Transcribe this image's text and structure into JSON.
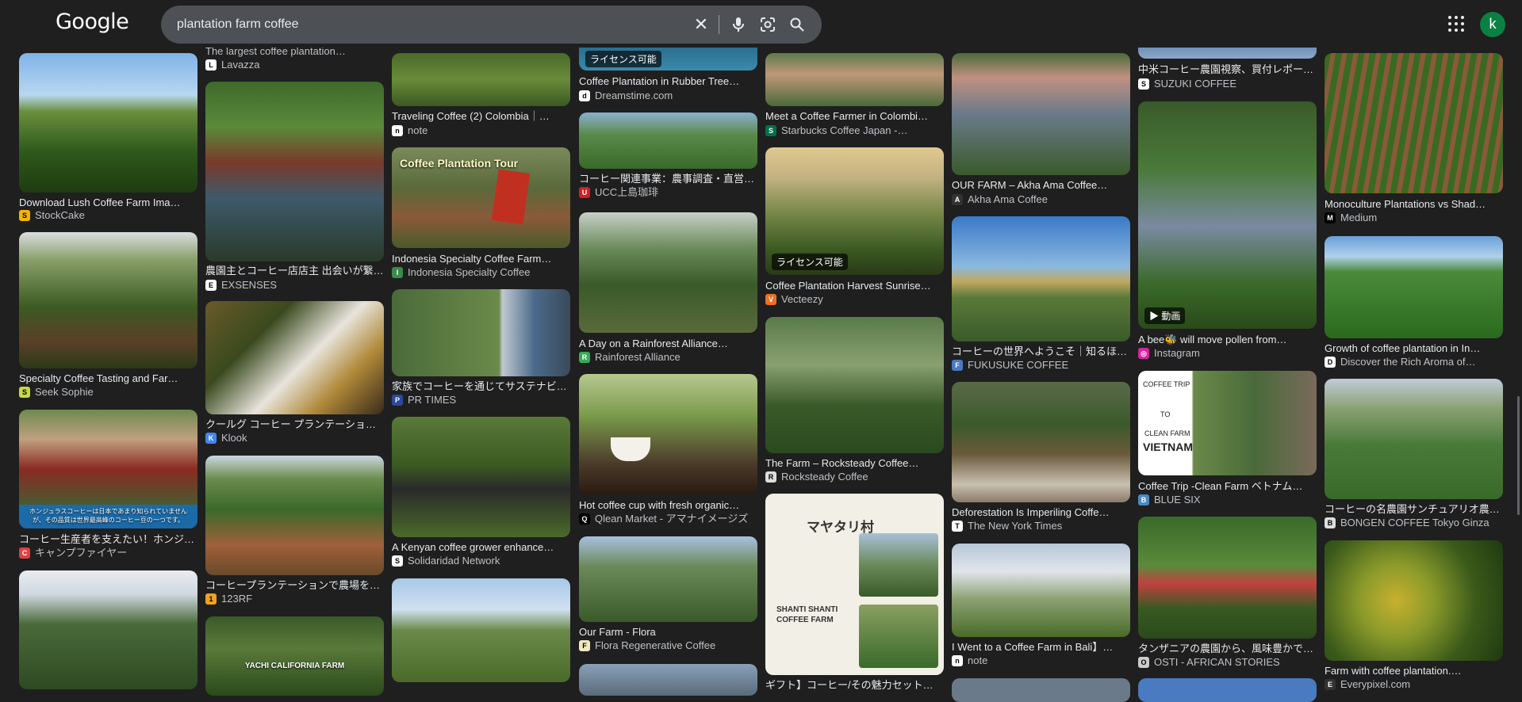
{
  "header": {
    "logo": "Google",
    "query": "plantation farm coffee",
    "badge_license": "ライセンス可能",
    "badge_video": "動画"
  },
  "col1": [
    {
      "title": "Download Lush Coffee Farm Ima…",
      "source": "StockCake",
      "fav": "S"
    },
    {
      "title": "Specialty Coffee Tasting and Far…",
      "source": "Seek Sophie",
      "fav": "S"
    },
    {
      "title": "コーヒー生産者を支えたい！ホンジ…",
      "source": "キャンプファイヤー",
      "fav": "C",
      "overlay": "ホンジュラスコーヒーは日本であまり知られていませんが、その品質は世界最高峰のコーヒー豆の一つです。"
    }
  ],
  "col2": [
    {
      "title": "The largest coffee plantation…",
      "source": "Lavazza",
      "fav": "L"
    },
    {
      "title": "農園主とコーヒー店店主 出会いが繋…",
      "source": "EXSENSES",
      "fav": "E"
    },
    {
      "title": "クールグ コーヒー プランテーショ…",
      "source": "Klook",
      "fav": "K"
    },
    {
      "title": "コーヒープランテーションで農場を…",
      "source": "123RF",
      "fav": "1"
    },
    {
      "overlay": "YACHI CALIFORNIA FARM"
    }
  ],
  "col3": [
    {
      "title": "Traveling Coffee (2) Colombia｜…",
      "source": "note",
      "fav": "n"
    },
    {
      "title": "Indonesia Specialty Coffee Farm…",
      "source": "Indonesia Specialty Coffee",
      "fav": "I",
      "overlay": "Coffee Plantation Tour"
    },
    {
      "title": "家族でコーヒーを通じてサステナビ…",
      "source": "PR TIMES",
      "fav": "P"
    },
    {
      "title": "A Kenyan coffee grower enhance…",
      "source": "Solidaridad Network",
      "fav": "S"
    }
  ],
  "col4": [
    {
      "title": "Coffee Plantation in Rubber Tree…",
      "source": "Dreamstime.com",
      "fav": "d"
    },
    {
      "title": "コーヒー関連事業：農事調査・直営…",
      "source": "UCC上島珈琲",
      "fav": "U"
    },
    {
      "title": "A Day on a Rainforest Alliance…",
      "source": "Rainforest Alliance",
      "fav": "R"
    },
    {
      "title": "Hot coffee cup with fresh organic…",
      "source": "Qlean Market - アマナイメージズ",
      "fav": "Q"
    },
    {
      "title": "Our Farm - Flora",
      "source": "Flora Regenerative Coffee",
      "fav": "F"
    }
  ],
  "col5": [
    {
      "title": "Meet a Coffee Farmer in Colombi…",
      "source": "Starbucks Coffee Japan -…",
      "fav": "S"
    },
    {
      "title": "Coffee Plantation Harvest Sunrise…",
      "source": "Vecteezy",
      "fav": "V"
    },
    {
      "title": "The Farm – Rocksteady Coffee…",
      "source": "Rocksteady Coffee",
      "fav": "R"
    },
    {
      "title": "ギフト】コーヒー/その魅力セット…",
      "overlay1": "マヤタリ村",
      "overlay2": "SHANTI SHANTI COFFEE FARM"
    }
  ],
  "col6": [
    {
      "title": "OUR FARM – Akha Ama Coffee…",
      "source": "Akha Ama Coffee",
      "fav": "A"
    },
    {
      "title": "コーヒーの世界へようこそ｜知るほ…",
      "source": "FUKUSUKE COFFEE",
      "fav": "F"
    },
    {
      "title": "Deforestation Is Imperiling Coffe…",
      "source": "The New York Times",
      "fav": "T"
    },
    {
      "title": "I Went to a Coffee Farm in Bali】…",
      "source": "note",
      "fav": "n"
    }
  ],
  "col7": [
    {
      "title": "中米コーヒー農園視察、買付レポー…",
      "source": "SUZUKI COFFEE",
      "fav": "S"
    },
    {
      "title": "A bee🐝 will move pollen from…",
      "source": "Instagram",
      "fav": "◎"
    },
    {
      "title": "Coffee Trip -Clean Farm ベトナム…",
      "source": "BLUE SIX",
      "fav": "B",
      "overlay1": "COFFEE TRIP",
      "overlay2": "TO",
      "overlay3": "CLEAN FARM",
      "overlay4": "VIETNAM"
    },
    {
      "title": "タンザニアの農園から、風味豊かで…",
      "source": "OSTI - AFRICAN STORIES",
      "fav": "O"
    }
  ],
  "col8": [
    {
      "title": "Monoculture Plantations vs Shad…",
      "source": "Medium",
      "fav": "M"
    },
    {
      "title": "Growth of coffee plantation in In…",
      "source": "Discover the Rich Aroma of…",
      "fav": "D"
    },
    {
      "title": "コーヒーの名農園サンチュアリオ農…",
      "source": "BONGEN COFFEE Tokyo Ginza",
      "fav": "B"
    },
    {
      "title": "Farm with coffee plantation.…",
      "source": "Everypixel.com",
      "fav": "E"
    }
  ]
}
